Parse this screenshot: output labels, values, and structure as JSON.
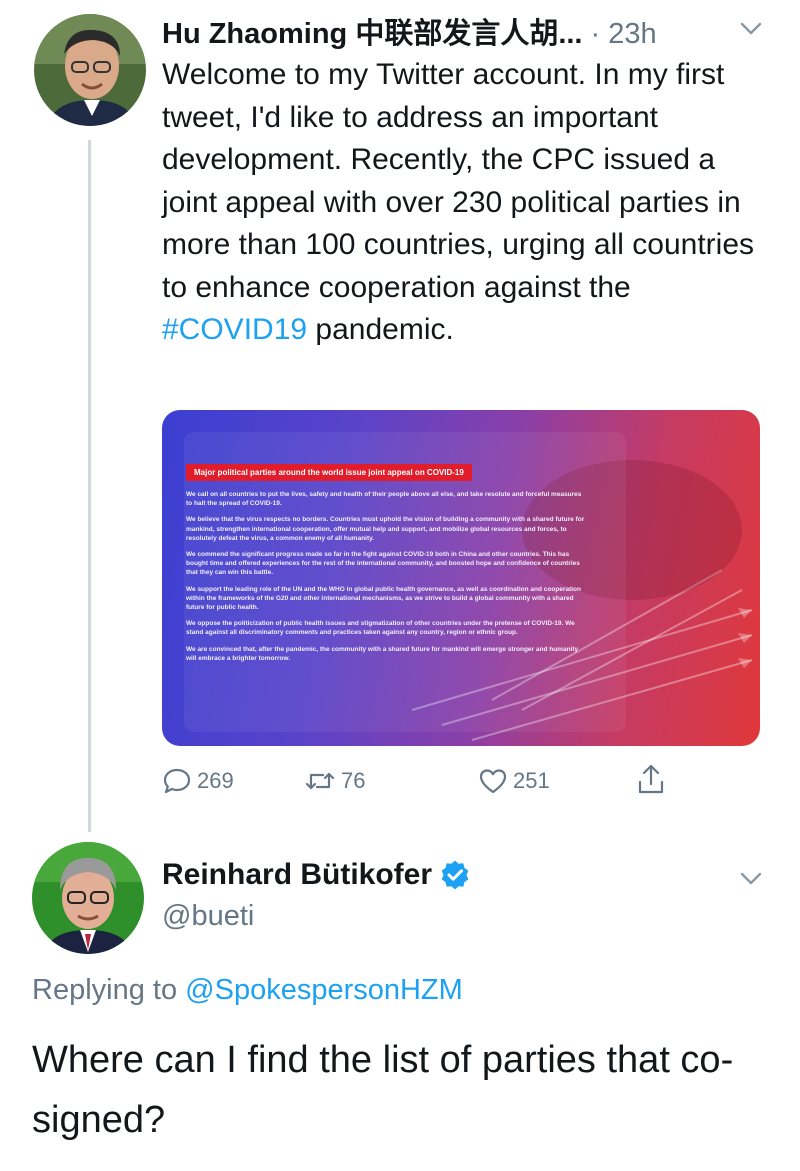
{
  "tweet1": {
    "author_name": "Hu Zhaoming 中联部发言人胡...",
    "separator": " · ",
    "time": "23h",
    "text_before_hashtag": "Welcome to my Twitter account. In my first tweet, I'd like to address an important development. Recently, the CPC issued a joint appeal with over 230 political parties in more than 100 countries, urging all countries to enhance cooperation against the ",
    "hashtag": "#COVID19",
    "text_after_hashtag": " pandemic.",
    "media": {
      "headline": "Major political parties around the world issue joint appeal on COVID-19",
      "paragraphs": [
        "We call on all countries to put the lives, safety and health of their people above all else, and take resolute and forceful measures to halt the spread of COVID-19.",
        "We believe that the virus respects no borders. Countries must uphold the vision of building a community with a shared future for mankind, strengthen international cooperation, offer mutual help and support, and mobilize global resources and forces, to resolutely defeat the virus, a common enemy of all humanity.",
        "We commend the significant progress made so far in the fight against COVID-19 both in China and other countries. This has bought time and offered experiences for the rest of the international community, and boosted hope and confidence of countries that they can win this battle.",
        "We support the leading role of the UN and the WHO in global public health governance, as well as coordination and cooperation within the frameworks of the G20 and other international mechanisms, as we strive to build a global community with a shared future for public health.",
        "We oppose the politicization of public health issues and stigmatization of other countries under the pretense of COVID-19. We stand against all discriminatory comments and practices taken against any country, region or ethnic group.",
        "We are convinced that, after the pandemic, the community with a shared future for mankind will emerge stronger and humanity will embrace a brighter tomorrow."
      ]
    },
    "actions": {
      "replies": "269",
      "retweets": "76",
      "likes": "251"
    }
  },
  "tweet2": {
    "author_name": "Reinhard Bütikofer",
    "handle": "@bueti",
    "replying_prefix": "Replying to ",
    "replying_to": "@SpokespersonHZM",
    "text": "Where can I find the list of parties that co-signed?"
  },
  "icons": {
    "reply": "speech-bubble-icon",
    "retweet": "retweet-arrows-icon",
    "like": "heart-icon",
    "share": "share-upload-icon",
    "verified": "verified-badge-icon",
    "more": "chevron-down-icon"
  },
  "colors": {
    "link": "#1da1f2",
    "secondary_text": "#657786",
    "primary_text": "#14171a",
    "thread_line": "#cfd9de"
  }
}
